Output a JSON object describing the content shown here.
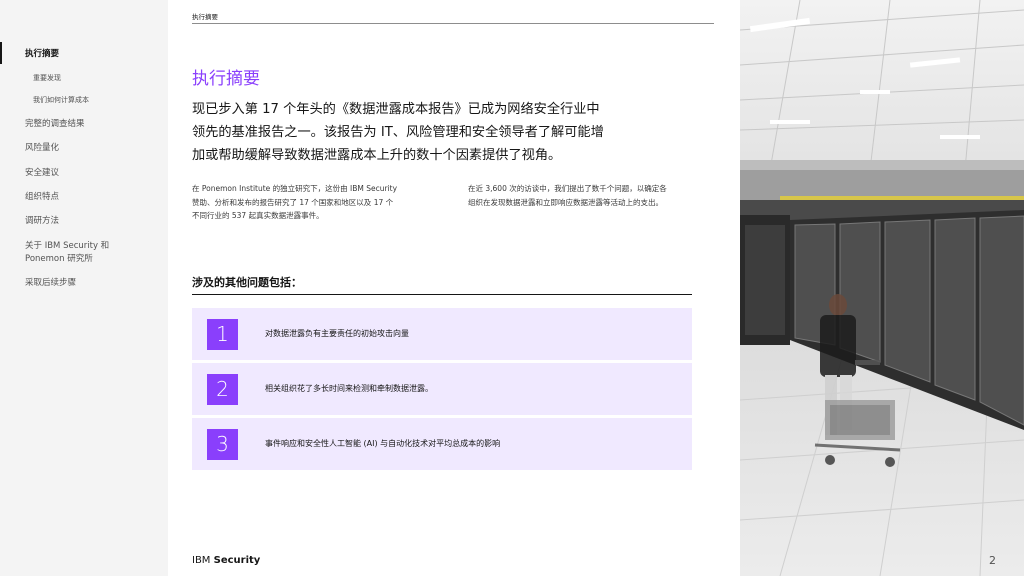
{
  "sidebar": {
    "items": [
      {
        "label": "执行摘要"
      },
      {
        "label": "重要发现"
      },
      {
        "label": "我们如何计算成本"
      },
      {
        "label": "完整的调查结果"
      },
      {
        "label": "风险量化"
      },
      {
        "label": "安全建议"
      },
      {
        "label": "组织特点"
      },
      {
        "label": "调研方法"
      },
      {
        "label": "关于 IBM Security 和"
      },
      {
        "label": "Ponemon 研究所"
      },
      {
        "label": "采取后续步骤"
      }
    ]
  },
  "header": {
    "section_label": "执行摘要"
  },
  "main": {
    "title": "执行摘要",
    "intro_lines": [
      "现已步入第 17 个年头的《数据泄露成本报告》已成为网络安全行业中",
      "领先的基准报告之一。该报告为 IT、风险管理和安全领导者了解可能增",
      "加或帮助缓解导致数据泄露成本上升的数十个因素提供了视角。"
    ],
    "col1_lines": [
      "在 Ponemon Institute 的独立研究下，这份由 IBM Security",
      "赞助、分析和发布的报告研究了 17 个国家和地区以及 17 个",
      "不同行业的 537 起真实数据泄露事件。"
    ],
    "col2_lines": [
      "在近 3,600 次的访谈中，我们提出了数千个问题，以确定各",
      "组织在发现数据泄露和立即响应数据泄露等活动上的支出。"
    ],
    "questions_heading": "涉及的其他问题包括：",
    "questions": [
      {
        "num": "1",
        "text": "对数据泄露负有主要责任的初始攻击向量"
      },
      {
        "num": "2",
        "text": "相关组织花了多长时间来检测和牵制数据泄露。"
      },
      {
        "num": "3",
        "text": "事件响应和安全性人工智能 (AI) 与自动化技术对平均总成本的影响"
      }
    ]
  },
  "footer": {
    "brand_ibm": "IBM",
    "brand_security": "Security",
    "page_number": "2"
  },
  "colors": {
    "accent": "#8a3ffc",
    "question_bg": "#f0e9ff",
    "sidebar_bg": "#f4f4f4"
  }
}
